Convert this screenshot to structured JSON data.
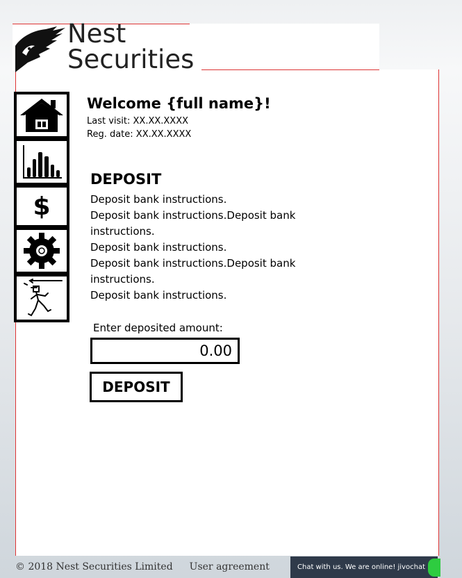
{
  "brand": {
    "line1": "Nest",
    "line2": "Securities"
  },
  "nav": [
    {
      "name": "home",
      "icon": "house-icon"
    },
    {
      "name": "portfolio",
      "icon": "bar-chart-icon"
    },
    {
      "name": "deposit",
      "icon": "dollar-icon",
      "glyph": "$"
    },
    {
      "name": "settings",
      "icon": "gear-icon"
    },
    {
      "name": "logout",
      "icon": "exit-figure-icon"
    }
  ],
  "header": {
    "welcome": "Welcome {full name}!",
    "last_visit": "Last visit: XX.XX.XXXX",
    "reg_date": "Reg. date: XX.XX.XXXX"
  },
  "deposit": {
    "title": "DEPOSIT",
    "instructions": [
      "Deposit bank instructions.",
      "Deposit bank instructions.Deposit bank instructions.",
      "Deposit bank instructions.",
      "Deposit bank instructions.Deposit bank instructions.",
      "Deposit bank instructions."
    ],
    "amount_label": "Enter deposited amount:",
    "amount_value": "0.00",
    "button_label": "DEPOSIT"
  },
  "footer": {
    "copyright": "© 2018 Nest Securities Limited",
    "agreement": "User agreement"
  },
  "chat": {
    "text": "Chat with us. We are online!",
    "brand": "jivochat"
  },
  "colors": {
    "accent_line": "#dd3333",
    "chat_bg": "#2f3a4a",
    "chat_status": "#2ecc40"
  }
}
